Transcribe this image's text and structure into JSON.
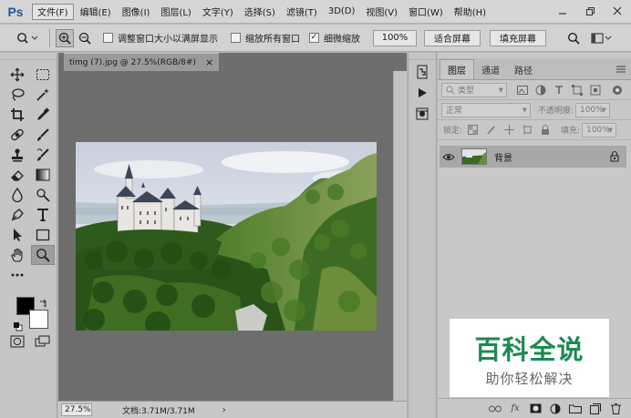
{
  "app": {
    "logo": "Ps"
  },
  "menu": {
    "items": [
      "文件(F)",
      "编辑(E)",
      "图像(I)",
      "图层(L)",
      "文字(Y)",
      "选择(S)",
      "滤镜(T)",
      "3D(D)",
      "视图(V)",
      "窗口(W)",
      "帮助(H)"
    ]
  },
  "options": {
    "resize_windows": "调整窗口大小以满屏显示",
    "zoom_all_windows": "缩放所有窗口",
    "scrubby_zoom": "细微缩放",
    "zoom_value": "100%",
    "fit_screen": "适合屏幕",
    "fill_screen": "填充屏幕",
    "checks": {
      "resize_windows": false,
      "zoom_all_windows": false,
      "scrubby_zoom": true
    }
  },
  "document": {
    "tab_title": "timg (7).jpg @ 27.5%(RGB/8#)",
    "close_glyph": "×",
    "zoom": "27.5%",
    "doc_info": "文档:3.71M/3.71M",
    "status_arrow": "›"
  },
  "layers_panel": {
    "tabs": [
      "图层",
      "通道",
      "路径"
    ],
    "filter_placeholder": "类型",
    "blend_mode": "正常",
    "opacity_label": "不透明度:",
    "opacity_value": "100%",
    "lock_label": "锁定:",
    "fill_label": "填充:",
    "fill_value": "100%",
    "layers": [
      {
        "name": "背景",
        "visible": true,
        "locked": true
      }
    ]
  },
  "watermark": {
    "title": "百科全说",
    "subtitle": "助你轻松解决"
  },
  "colors": {
    "foreground": "#000000",
    "background": "#ffffff",
    "watermark_green": "#1c8a52"
  }
}
